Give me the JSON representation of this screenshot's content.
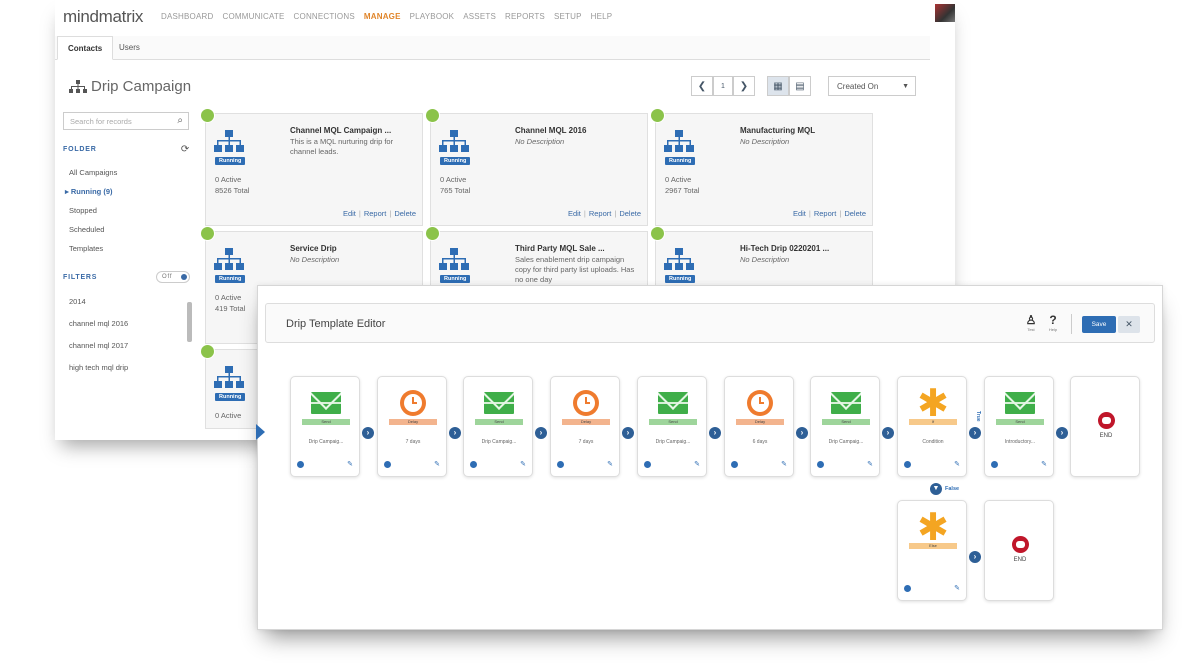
{
  "brand": {
    "logo_text": "mindmatrix"
  },
  "nav": {
    "items": [
      "DASHBOARD",
      "COMMUNICATE",
      "CONNECTIONS",
      "MANAGE",
      "PLAYBOOK",
      "ASSETS",
      "REPORTS",
      "SETUP",
      "HELP"
    ],
    "active": "MANAGE"
  },
  "subtabs": [
    "Contacts",
    "Users"
  ],
  "page": {
    "title": "Drip Campaign"
  },
  "pager": {
    "prev": "❮",
    "page": "1",
    "next": "❯",
    "sort_label": "Created On"
  },
  "sidebar": {
    "search_placeholder": "Search for records",
    "folder_heading": "FOLDER",
    "folders": [
      "All Campaigns",
      "▸ Running  (9)",
      "Stopped",
      "Scheduled",
      "Templates"
    ],
    "filters_heading": "FILTERS",
    "filter_toggle": "Off",
    "filters": [
      "2014",
      "channel mql 2016",
      "channel mql 2017",
      "high tech mql drip"
    ]
  },
  "cards": [
    {
      "title": "Channel MQL Campaign ...",
      "desc": "This is a MQL nurturing drip for channel leads.",
      "nodesc": false,
      "status": "Running",
      "active": "0 Active",
      "total": "8526 Total"
    },
    {
      "title": "Channel MQL 2016",
      "desc": "No Description",
      "nodesc": true,
      "status": "Running",
      "active": "0 Active",
      "total": "765 Total"
    },
    {
      "title": "Manufacturing MQL",
      "desc": "No Description",
      "nodesc": true,
      "status": "Running",
      "active": "0 Active",
      "total": "2967 Total"
    },
    {
      "title": "Service Drip",
      "desc": "No Description",
      "nodesc": true,
      "status": "Running",
      "active": "0 Active",
      "total": "419 Total"
    },
    {
      "title": "Third Party MQL Sale ...",
      "desc": "Sales enablement drip campaign copy for third party list uploads. Has no one day",
      "nodesc": false,
      "status": "Running",
      "active": "",
      "total": ""
    },
    {
      "title": "Hi-Tech Drip 0220201 ...",
      "desc": "No Description",
      "nodesc": true,
      "status": "Running",
      "active": "",
      "total": ""
    },
    {
      "title": "",
      "desc": "",
      "nodesc": false,
      "status": "Running",
      "active": "0 Active",
      "total": ""
    }
  ],
  "card_links": {
    "edit": "Edit",
    "report": "Report",
    "delete": "Delete"
  },
  "editor": {
    "title": "Drip Template Editor",
    "tools": [
      {
        "glyph": "♙",
        "label": "Test"
      },
      {
        "glyph": "?",
        "label": "Help"
      }
    ],
    "save_label": "Save",
    "expand_glyph": "✕",
    "true_label": "True",
    "false_label": "False",
    "nodes": [
      {
        "kind": "send",
        "tag": "Send",
        "label": "Drip Campaig..."
      },
      {
        "kind": "delay",
        "tag": "Delay",
        "label": "7 days"
      },
      {
        "kind": "send",
        "tag": "Send",
        "label": "Drip Campaig..."
      },
      {
        "kind": "delay",
        "tag": "Delay",
        "label": "7 days"
      },
      {
        "kind": "send",
        "tag": "Send",
        "label": "Drip Campaig..."
      },
      {
        "kind": "delay",
        "tag": "Delay",
        "label": "6 days"
      },
      {
        "kind": "send",
        "tag": "Send",
        "label": "Drip Campaig..."
      },
      {
        "kind": "cond",
        "tag": "If",
        "label": "Condition"
      },
      {
        "kind": "send",
        "tag": "Send",
        "label": "Introductory..."
      },
      {
        "kind": "end",
        "tag": "",
        "label": "END"
      }
    ],
    "else_node": {
      "kind": "else",
      "tag": "Else",
      "label": ""
    },
    "else_end": {
      "kind": "end",
      "tag": "",
      "label": "END"
    }
  },
  "colors": {
    "accent": "#2e6db4",
    "brand_orange": "#e0852a",
    "send_green": "#3fae49",
    "delay_orange": "#ef7b2e",
    "cond_yellow": "#f4a522",
    "end_red": "#c0162a"
  }
}
